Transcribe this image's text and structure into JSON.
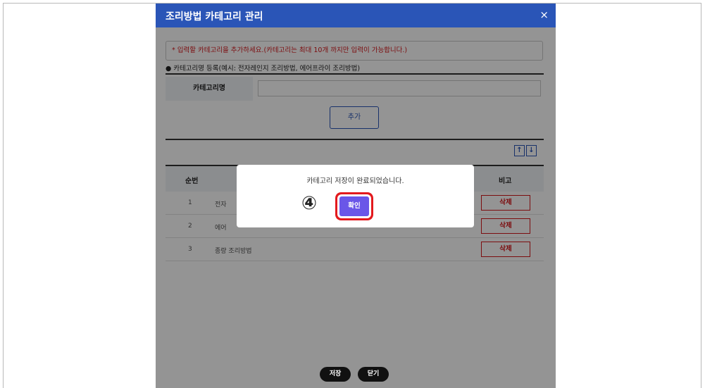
{
  "modal": {
    "title": "조리방법 카테고리 관리",
    "close_icon": "×",
    "notice": "* 입력할 카테고리을 추가하세요.(카테고리는 최대 10개 까지만 입력이 가능합니다.)",
    "guide": "● 카테고리명 등록(예시: 전자레인지 조리방법, 에어프라이 조리방법)",
    "form": {
      "label": "카테고리명",
      "input_value": "",
      "input_placeholder": ""
    },
    "add_button": "추가",
    "sort": {
      "up_icon": "🠕",
      "down_icon": "🠗",
      "up_symbol": "↑",
      "down_symbol": "↓"
    },
    "table": {
      "headers": {
        "num": "순번",
        "note": "비고"
      },
      "rows": [
        {
          "num": "1",
          "name": "전자",
          "action": "삭제"
        },
        {
          "num": "2",
          "name": "에어",
          "action": "삭제"
        },
        {
          "num": "3",
          "name": "종량 조리방법",
          "action": "삭제"
        }
      ]
    },
    "footer": {
      "save": "저장",
      "close": "닫기"
    }
  },
  "dialog": {
    "message": "카테고리 저장이 완료되었습니다.",
    "confirm": "확인",
    "step_marker": "④"
  },
  "colors": {
    "header_blue": "#2a55b7",
    "notice_red": "#d6171b",
    "confirm_purple": "#6a56e8",
    "highlight_red": "#e3191d"
  }
}
